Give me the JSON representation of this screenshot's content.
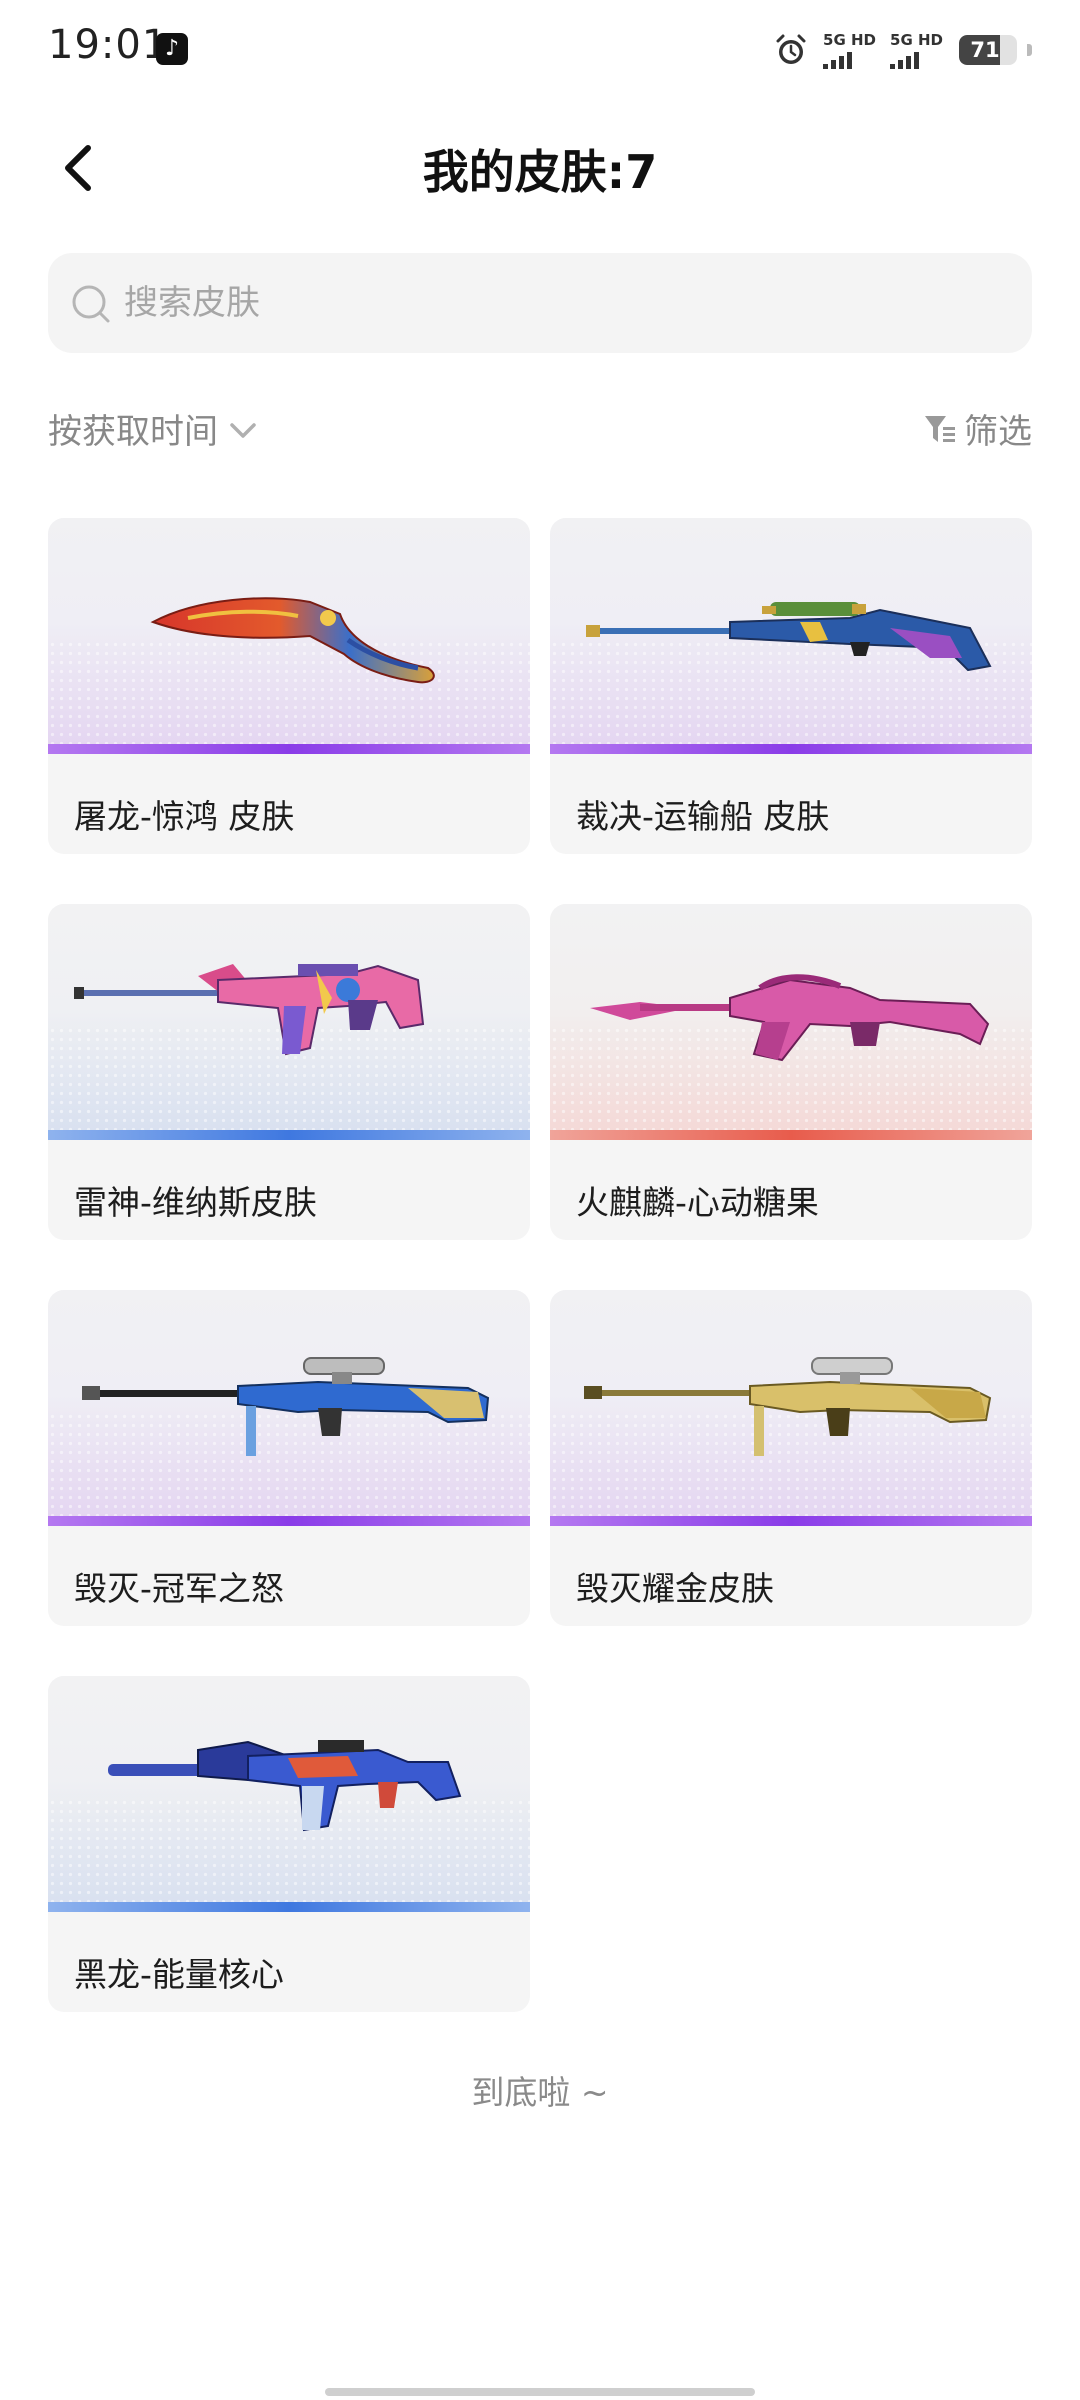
{
  "status_bar": {
    "time": "19:01",
    "app_icon": "tiktok-icon",
    "alarm_icon": "alarm-icon",
    "network1": "5G HD",
    "network2": "5G HD",
    "battery": "71",
    "battery_level": 0.71
  },
  "header": {
    "title": "我的皮肤:7",
    "back_icon": "chevron-left-icon"
  },
  "search": {
    "placeholder": "搜索皮肤",
    "value": ""
  },
  "sort": {
    "label": "按获取时间",
    "icon": "chevron-down-icon"
  },
  "filter": {
    "label": "筛选",
    "icon": "filter-icon"
  },
  "colors": {
    "purple": "#8a3ce8",
    "blue": "#3f78e0",
    "red": "#e85c4c"
  },
  "skins": [
    {
      "name": "屠龙-惊鸿 皮肤",
      "rarity": "purple",
      "weapon": "knife"
    },
    {
      "name": "裁决-运输船 皮肤",
      "rarity": "purple",
      "weapon": "sniper"
    },
    {
      "name": "雷神-维纳斯皮肤",
      "rarity": "blue",
      "weapon": "assault-rifle"
    },
    {
      "name": "火麒麟-心动糖果",
      "rarity": "red",
      "weapon": "ak-rifle"
    },
    {
      "name": "毁灭-冠军之怒",
      "rarity": "purple",
      "weapon": "heavy-sniper"
    },
    {
      "name": "毁灭耀金皮肤",
      "rarity": "purple",
      "weapon": "heavy-sniper-gold"
    },
    {
      "name": "黑龙-能量核心",
      "rarity": "blue",
      "weapon": "carbine"
    }
  ],
  "footer": {
    "end_text": "到底啦 ~"
  }
}
